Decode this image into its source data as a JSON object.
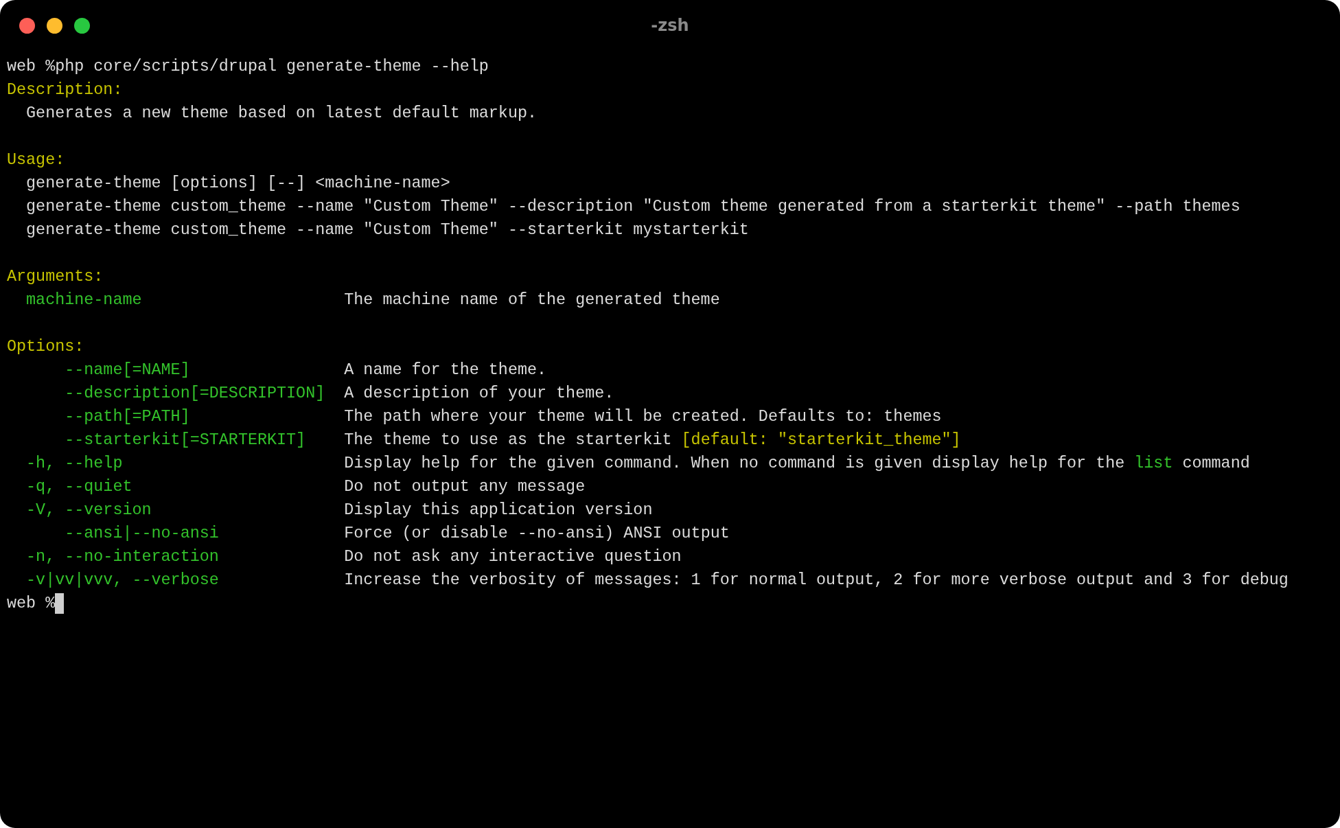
{
  "window": {
    "title": "-zsh"
  },
  "lines": [
    {
      "kind": "command",
      "prompt": "web %",
      "text": "php core/scripts/drupal generate-theme --help"
    },
    {
      "kind": "heading",
      "text": "Description:"
    },
    {
      "kind": "indented",
      "text": "Generates a new theme based on latest default markup."
    },
    {
      "kind": "blank"
    },
    {
      "kind": "heading",
      "text": "Usage:"
    },
    {
      "kind": "indented",
      "text": "generate-theme [options] [--] <machine-name>"
    },
    {
      "kind": "indented",
      "text": "generate-theme custom_theme --name \"Custom Theme\" --description \"Custom theme generated from a starterkit theme\" --path themes"
    },
    {
      "kind": "indented",
      "text": "generate-theme custom_theme --name \"Custom Theme\" --starterkit mystarterkit"
    },
    {
      "kind": "blank"
    },
    {
      "kind": "heading",
      "text": "Arguments:"
    },
    {
      "kind": "short",
      "name": "machine-name",
      "desc": [
        {
          "kind": "plain",
          "text": "The machine name of the generated theme"
        }
      ]
    },
    {
      "kind": "blank"
    },
    {
      "kind": "heading",
      "text": "Options:"
    },
    {
      "kind": "long",
      "name": "--name[=NAME]",
      "desc": [
        {
          "kind": "plain",
          "text": "A name for the theme."
        }
      ]
    },
    {
      "kind": "long",
      "name": "--description[=DESCRIPTION]",
      "desc": [
        {
          "kind": "plain",
          "text": "A description of your theme."
        }
      ]
    },
    {
      "kind": "long",
      "name": "--path[=PATH]",
      "desc": [
        {
          "kind": "plain",
          "text": "The path where your theme will be created. Defaults to: themes"
        }
      ]
    },
    {
      "kind": "long",
      "name": "--starterkit[=STARTERKIT]",
      "desc": [
        {
          "kind": "plain",
          "text": "The theme to use as the starterkit "
        },
        {
          "kind": "yellow",
          "text": "[default: \"starterkit_theme\"]"
        }
      ]
    },
    {
      "kind": "short",
      "name": "-h, --help",
      "desc": [
        {
          "kind": "plain",
          "text": "Display help for the given command. When no command is given display help for the "
        },
        {
          "kind": "green",
          "text": "list"
        },
        {
          "kind": "plain",
          "text": " command"
        }
      ]
    },
    {
      "kind": "short",
      "name": "-q, --quiet",
      "desc": [
        {
          "kind": "plain",
          "text": "Do not output any message"
        }
      ]
    },
    {
      "kind": "short",
      "name": "-V, --version",
      "desc": [
        {
          "kind": "plain",
          "text": "Display this application version"
        }
      ]
    },
    {
      "kind": "long",
      "name": "--ansi|--no-ansi",
      "desc": [
        {
          "kind": "plain",
          "text": "Force (or disable --no-ansi) ANSI output"
        }
      ]
    },
    {
      "kind": "short",
      "name": "-n, --no-interaction",
      "desc": [
        {
          "kind": "plain",
          "text": "Do not ask any interactive question"
        }
      ]
    },
    {
      "kind": "short",
      "name": "-v|vv|vvv, --verbose",
      "desc": [
        {
          "kind": "plain",
          "text": "Increase the verbosity of messages: 1 for normal output, 2 for more verbose output and 3 for debug"
        }
      ]
    },
    {
      "kind": "prompt",
      "prompt": "web %",
      "cursor": true
    }
  ]
}
